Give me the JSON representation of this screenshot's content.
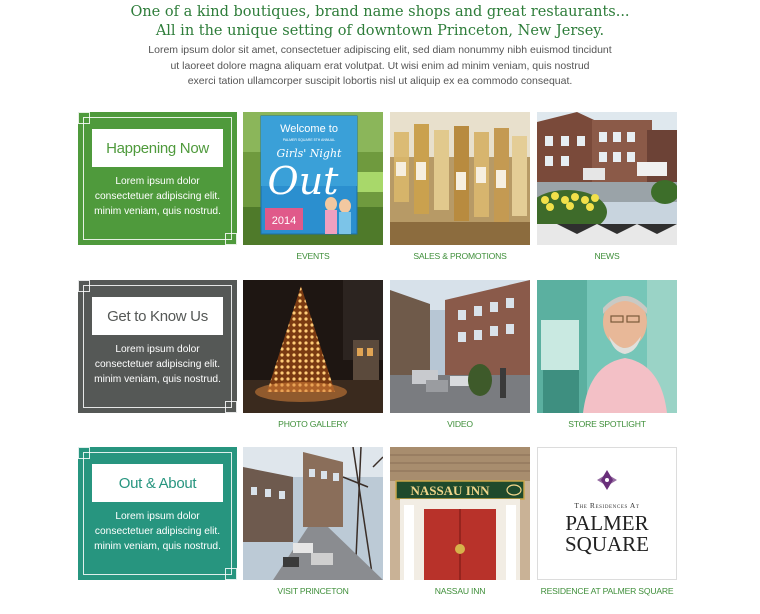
{
  "intro": {
    "headline_line1": "One of a kind boutiques, brand name shops and great restaurants...",
    "headline_line2": "All in the unique setting of downtown Princeton, New Jersey.",
    "body_line1": "Lorem ipsum dolor sit amet, consectetuer adipiscing elit, sed diam nonummy nibh euismod tincidunt",
    "body_line2": "ut laoreet dolore magna aliquam erat volutpat. Ut wisi enim ad minim veniam, quis nostrud",
    "body_line3": "exerci tation ullamcorper suscipit lobortis nisl ut aliquip ex ea commodo consequat."
  },
  "colors": {
    "green": "#4f9a3c",
    "gray": "#555856",
    "teal": "#27957f",
    "caption": "#3f8f3a"
  },
  "panels": [
    {
      "title": "Happening Now",
      "line1": "Lorem ipsum dolor",
      "line2": "consectetuer adipiscing elit.",
      "line3": "minim veniam, quis nostrud."
    },
    {
      "title": "Get to Know Us",
      "line1": "Lorem ipsum dolor",
      "line2": "consectetuer adipiscing elit.",
      "line3": "minim veniam, quis nostrud."
    },
    {
      "title": "Out & About",
      "line1": "Lorem ipsum dolor",
      "line2": "consectetuer adipiscing elit.",
      "line3": "minim veniam, quis nostrud."
    }
  ],
  "tiles": {
    "events": {
      "caption": "EVENTS",
      "poster_welcome": "Welcome to",
      "poster_small": "PALMER SQUARE 5TH ANNUAL",
      "poster_girls": "Girls' Night",
      "poster_out": "Out",
      "poster_year": "2014"
    },
    "sales": {
      "caption": "SALES & PROMOTIONS"
    },
    "news": {
      "caption": "NEWS"
    },
    "gallery": {
      "caption": "PHOTO GALLERY"
    },
    "video": {
      "caption": "VIDEO"
    },
    "spotlight": {
      "caption": "STORE SPOTLIGHT"
    },
    "visit": {
      "caption": "VISIT PRINCETON"
    },
    "nassau": {
      "caption": "NASSAU INN",
      "sign": "NASSAU INN"
    },
    "residence": {
      "caption": "RESIDENCE AT PALMER SQUARE",
      "small": "The Residences At",
      "big1": "PALMER",
      "big2": "SQUARE"
    }
  }
}
